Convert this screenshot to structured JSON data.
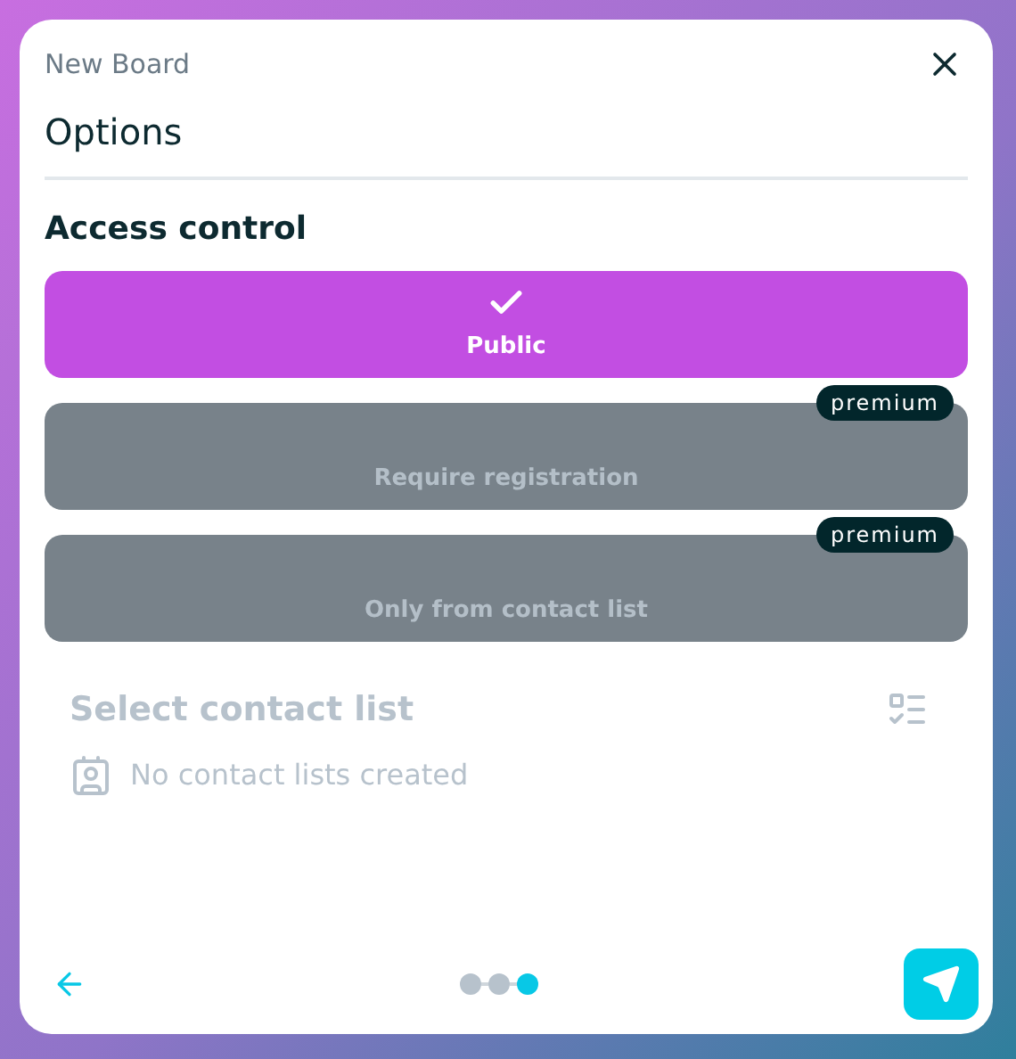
{
  "dialog": {
    "subtitle": "New Board",
    "title": "Options"
  },
  "section": {
    "heading": "Access control"
  },
  "options": [
    {
      "label": "Public",
      "selected": true,
      "disabled": false
    },
    {
      "label": "Require registration",
      "selected": false,
      "disabled": true,
      "badge": "premium"
    },
    {
      "label": "Only from contact list",
      "selected": false,
      "disabled": true,
      "badge": "premium"
    }
  ],
  "contact_list": {
    "placeholder": "Select contact list",
    "empty_message": "No contact lists created",
    "disabled": true
  },
  "steps": [
    {
      "selected": false
    },
    {
      "selected": false
    },
    {
      "selected": true
    }
  ]
}
